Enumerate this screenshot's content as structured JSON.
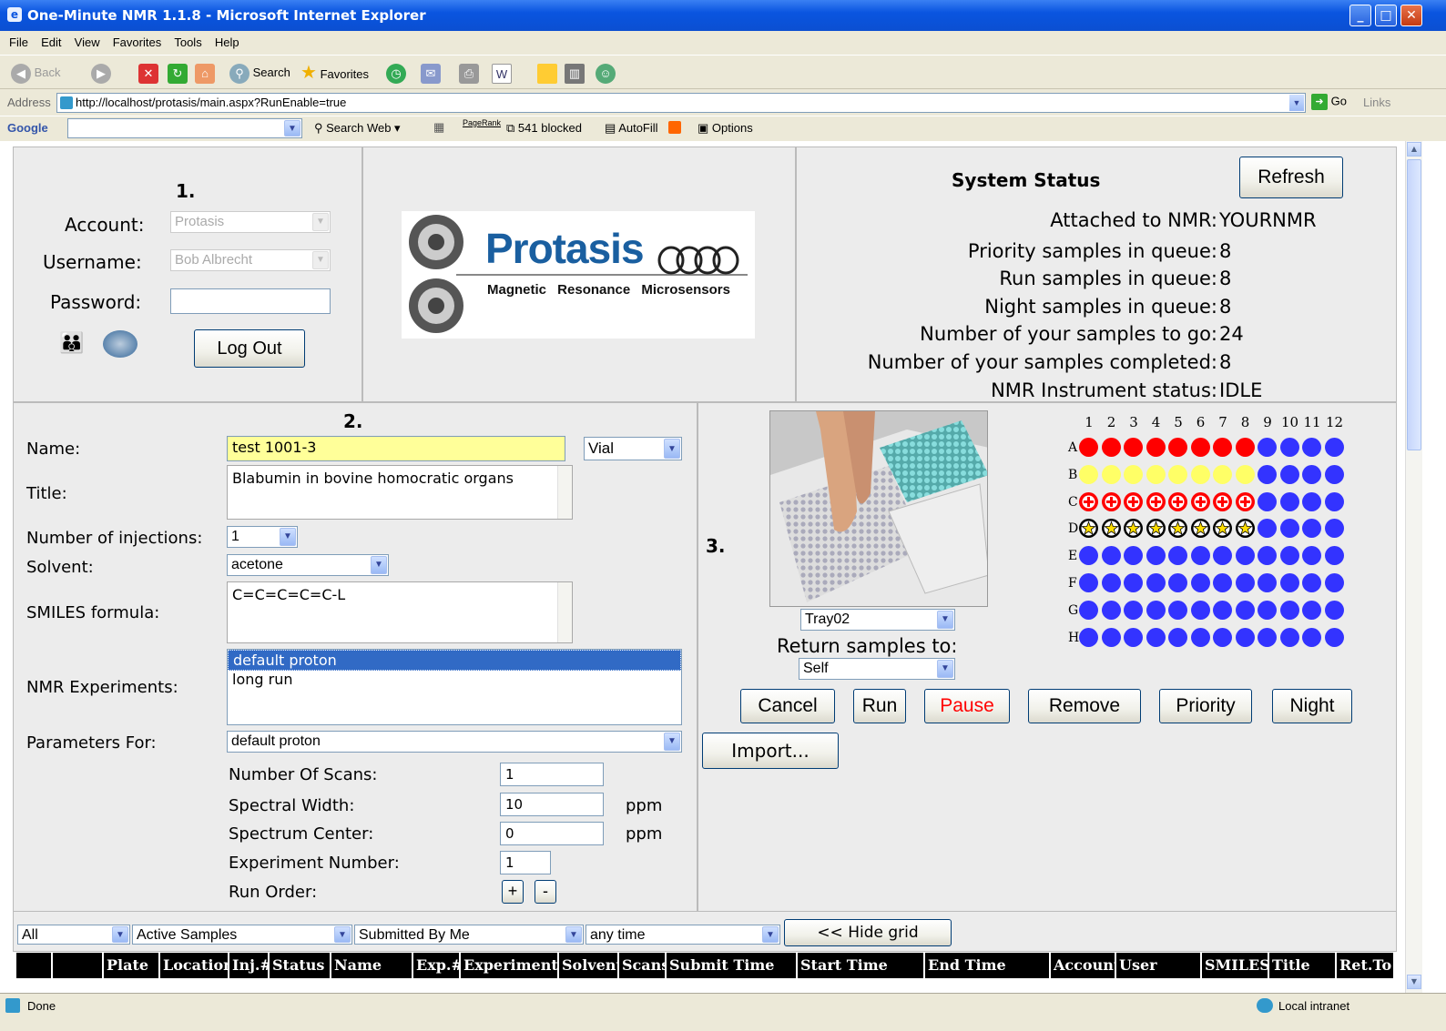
{
  "window": {
    "title": "One-Minute NMR 1.1.8 - Microsoft Internet Explorer"
  },
  "menu": [
    "File",
    "Edit",
    "View",
    "Favorites",
    "Tools",
    "Help"
  ],
  "toolbar": {
    "back": "Back",
    "search": "Search",
    "favorites": "Favorites"
  },
  "address": {
    "label": "Address",
    "url": "http://localhost/protasis/main.aspx?RunEnable=true",
    "go": "Go",
    "links": "Links"
  },
  "googlebar": {
    "brand": "Google",
    "search_web": "Search Web",
    "pagerank": "PageRank",
    "blocked": "541 blocked",
    "autofill": "AutoFill",
    "options": "Options"
  },
  "login": {
    "step": "1.",
    "account_label": "Account:",
    "account_value": "Protasis",
    "username_label": "Username:",
    "username_value": "Bob Albrecht",
    "password_label": "Password:",
    "password_value": "",
    "logout": "Log Out"
  },
  "logo": {
    "name": "Protasis",
    "tagline": "Magnetic Resonance Microsensors"
  },
  "status": {
    "heading": "System Status",
    "refresh": "Refresh",
    "rows": [
      {
        "label": "Attached to NMR:",
        "value": "YOURNMR"
      },
      {
        "label": "Priority samples in queue:",
        "value": "8"
      },
      {
        "label": "Run samples in queue:",
        "value": "8"
      },
      {
        "label": "Night samples in queue:",
        "value": "8"
      },
      {
        "label": "Number of your samples to go:",
        "value": "24"
      },
      {
        "label": "Number of your samples completed:",
        "value": "8"
      },
      {
        "label": "NMR Instrument status:",
        "value": "IDLE"
      }
    ]
  },
  "sample": {
    "step": "2.",
    "name_label": "Name:",
    "name_value": "test 1001-3",
    "container": "Vial",
    "title_label": "Title:",
    "title_value": "Blabumin in bovine homocratic organs",
    "injections_label": "Number of injections:",
    "injections_value": "1",
    "solvent_label": "Solvent:",
    "solvent_value": "acetone",
    "smiles_label": "SMILES formula:",
    "smiles_value": "C=C=C=C=C-L",
    "experiments_label": "NMR Experiments:",
    "experiments": [
      "default proton",
      "long run"
    ],
    "params_label": "Parameters For:",
    "params_value": "default proton",
    "scans_label": "Number Of Scans:",
    "scans_value": "1",
    "width_label": "Spectral Width:",
    "width_value": "10",
    "width_unit": "ppm",
    "center_label": "Spectrum Center:",
    "center_value": "0",
    "center_unit": "ppm",
    "expnum_label": "Experiment Number:",
    "expnum_value": "1",
    "runorder_label": "Run Order:",
    "plus": "+",
    "minus": "-"
  },
  "tray": {
    "step": "3.",
    "tray_value": "Tray02",
    "return_label": "Return samples to:",
    "return_value": "Self",
    "columns": [
      "1",
      "2",
      "3",
      "4",
      "5",
      "6",
      "7",
      "8",
      "9",
      "10",
      "11",
      "12"
    ],
    "rows": [
      "A",
      "B",
      "C",
      "D",
      "E",
      "F",
      "G",
      "H"
    ],
    "wells": [
      [
        "red",
        "red",
        "red",
        "red",
        "red",
        "red",
        "red",
        "red",
        "blue",
        "blue",
        "blue",
        "blue"
      ],
      [
        "yellow",
        "yellow",
        "yellow",
        "yellow",
        "yellow",
        "yellow",
        "yellow",
        "yellow",
        "blue",
        "blue",
        "blue",
        "blue"
      ],
      [
        "redcross",
        "redcross",
        "redcross",
        "redcross",
        "redcross",
        "redcross",
        "redcross",
        "redcross",
        "blue",
        "blue",
        "blue",
        "blue"
      ],
      [
        "star",
        "star",
        "star",
        "star",
        "star",
        "star",
        "star",
        "star",
        "blue",
        "blue",
        "blue",
        "blue"
      ],
      [
        "blue",
        "blue",
        "blue",
        "blue",
        "blue",
        "blue",
        "blue",
        "blue",
        "blue",
        "blue",
        "blue",
        "blue"
      ],
      [
        "blue",
        "blue",
        "blue",
        "blue",
        "blue",
        "blue",
        "blue",
        "blue",
        "blue",
        "blue",
        "blue",
        "blue"
      ],
      [
        "blue",
        "blue",
        "blue",
        "blue",
        "blue",
        "blue",
        "blue",
        "blue",
        "blue",
        "blue",
        "blue",
        "blue"
      ],
      [
        "blue",
        "blue",
        "blue",
        "blue",
        "blue",
        "blue",
        "blue",
        "blue",
        "blue",
        "blue",
        "blue",
        "blue"
      ]
    ],
    "colors": {
      "red": "#ff0000",
      "yellow": "#ffff66",
      "blue": "#3333ff",
      "star": "#000000",
      "pause": "#ff0000"
    },
    "buttons": {
      "cancel": "Cancel",
      "run": "Run",
      "pause": "Pause",
      "remove": "Remove",
      "priority": "Priority",
      "night": "Night",
      "import": "Import..."
    }
  },
  "filters": {
    "scope": "All",
    "samples": "Active Samples",
    "submitted": "Submitted By Me",
    "time": "any time",
    "hide_grid": "<< Hide grid"
  },
  "grid": {
    "columns": [
      "",
      "",
      "Plate",
      "Location",
      "Inj.#",
      "Status",
      "Name",
      "Exp.#",
      "Experiment",
      "Solvent",
      "Scans",
      "Submit Time",
      "Start Time",
      "End Time",
      "Account",
      "User",
      "SMILES",
      "Title",
      "Ret.To"
    ]
  },
  "statusbar": {
    "left": "Done",
    "right": "Local intranet"
  }
}
